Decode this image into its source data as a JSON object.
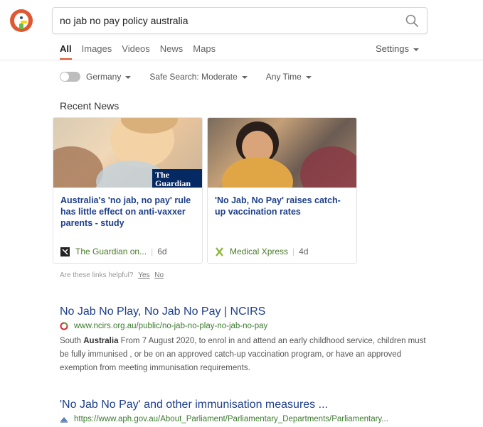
{
  "search": {
    "value": "no jab no pay policy australia"
  },
  "nav": {
    "tabs": [
      {
        "label": "All",
        "active": true
      },
      {
        "label": "Images"
      },
      {
        "label": "Videos"
      },
      {
        "label": "News"
      },
      {
        "label": "Maps"
      }
    ],
    "settings_label": "Settings"
  },
  "filters": {
    "region": "Germany",
    "region_enabled": false,
    "safe_search": "Safe Search: Moderate",
    "time": "Any Time"
  },
  "recent_news": {
    "title": "Recent News",
    "cards": [
      {
        "headline": "Australia's 'no jab, no pay' rule has little effect on anti-vaxxer parents - study",
        "source": "The Guardian on...",
        "age": "6d",
        "image_text": "The Guardian"
      },
      {
        "headline": "'No Jab, No Pay' raises catch-up vaccination rates",
        "source": "Medical Xpress",
        "age": "4d"
      }
    ],
    "helpful_question": "Are these links helpful?",
    "yes_label": "Yes",
    "no_label": "No"
  },
  "results": [
    {
      "title": "No Jab No Play, No Jab No Pay | NCIRS",
      "url": "www.ncirs.org.au/public/no-jab-no-play-no-jab-no-pay",
      "snippet_prefix": "South ",
      "snippet_bold": "Australia",
      "snippet_rest": " From 7 August 2020, to enrol in and attend an early childhood service, children must be fully immunised , or be on an approved catch-up vaccination program, or have an approved exemption from meeting immunisation requirements."
    },
    {
      "title": "'No Jab No Pay' and other immunisation measures ...",
      "url": "https://www.aph.gov.au/About_Parliament/Parliamentary_Departments/Parliamentary..."
    }
  ],
  "colors": {
    "brand": "#de5833",
    "link": "#1e3f8a",
    "url": "#3c7b2f"
  }
}
